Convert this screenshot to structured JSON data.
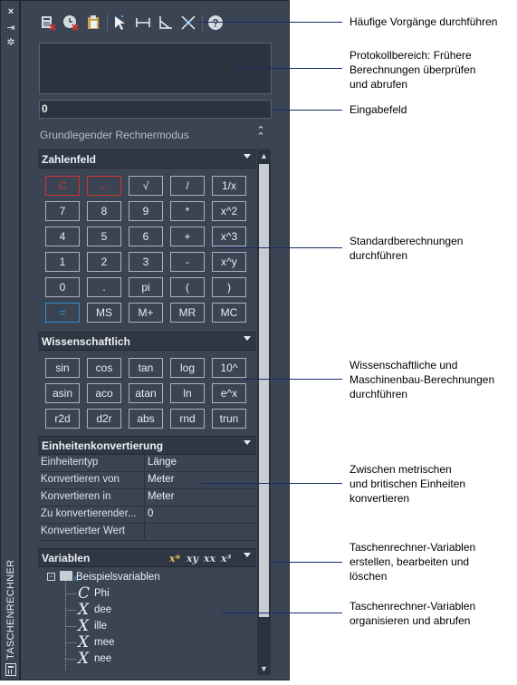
{
  "titlebar": {
    "close_icon": "×",
    "pin_icon": "⇥",
    "settings_icon": "✲",
    "title": "TASCHENRECHNER"
  },
  "toolbar": {
    "tools": [
      "clear-icon",
      "clear-history-icon",
      "paste-icon",
      "get-point-icon",
      "distance-icon",
      "angle-icon",
      "intersection-icon",
      "help-icon"
    ]
  },
  "input": {
    "value": "0"
  },
  "mode": {
    "label": "Grundlegender Rechnermodus",
    "collapse_icon": "⌃"
  },
  "numpad": {
    "title": "Zahlenfeld",
    "rows": [
      [
        "C",
        "←",
        "√",
        "/",
        "1/x"
      ],
      [
        "7",
        "8",
        "9",
        "*",
        "x^2"
      ],
      [
        "4",
        "5",
        "6",
        "+",
        "x^3"
      ],
      [
        "1",
        "2",
        "3",
        "-",
        "x^y"
      ],
      [
        "0",
        ".",
        "pi",
        "(",
        ")"
      ],
      [
        "=",
        "MS",
        "M+",
        "MR",
        "MC"
      ]
    ]
  },
  "scientific": {
    "title": "Wissenschaftlich",
    "rows": [
      [
        "sin",
        "cos",
        "tan",
        "log",
        "10^"
      ],
      [
        "asin",
        "aco",
        "atan",
        "ln",
        "e^x"
      ],
      [
        "r2d",
        "d2r",
        "abs",
        "rnd",
        "trun"
      ]
    ]
  },
  "units": {
    "title": "Einheitenkonvertierung",
    "rows": [
      {
        "key": "Einheitentyp",
        "value": "Länge"
      },
      {
        "key": "Konvertieren von",
        "value": "Meter"
      },
      {
        "key": "Konvertieren in",
        "value": "Meter"
      },
      {
        "key": "Zu  konvertierender...",
        "value": "0"
      },
      {
        "key": "Konvertierter Wert",
        "value": ""
      }
    ]
  },
  "variables": {
    "title": "Variablen",
    "root": "Beispielsvariablen",
    "items": [
      {
        "icon": "C",
        "name": "Phi"
      },
      {
        "icon": "X",
        "name": "dee"
      },
      {
        "icon": "X",
        "name": "ille"
      },
      {
        "icon": "X",
        "name": "mee"
      },
      {
        "icon": "X",
        "name": "nee"
      }
    ]
  },
  "callouts": [
    "Häufige Vorgänge durchführen",
    "Protokollbereich: Frühere\nBerechnungen überprüfen\nund abrufen",
    "Eingabefeld",
    "Standardberechnungen\ndurchführen",
    "Wissenschaftliche und\nMaschinenbau-Berechnungen\ndurchführen",
    "Zwischen metrischen\nund britischen Einheiten\nkonvertieren",
    "Taschenrechner-Variablen\nerstellen, bearbeiten und\nlöschen",
    "Taschenrechner-Variablen\norganisieren und abrufen"
  ],
  "colors": {
    "panel_bg": "#3b4453",
    "field_bg": "#2c333f",
    "clear_key": "#d23232",
    "equals_key": "#2f8fd6",
    "leader_line": "#1a2a6b"
  }
}
